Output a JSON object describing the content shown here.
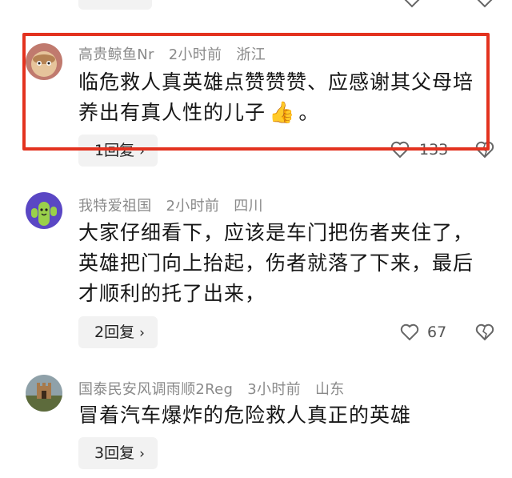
{
  "comments": [
    {
      "user": "高贵鲸鱼Nr",
      "time": "2小时前",
      "location": "浙江",
      "lines": [
        "临危救人真英雄点赞赞赞、应感谢其父母培",
        "养出有真人性的儿子"
      ],
      "emoji": "👍",
      "trailing": "。",
      "reply_label": "1回复",
      "likes": "133",
      "avatar_color": "#b06a5e"
    },
    {
      "user": "我特爱祖国",
      "time": "2小时前",
      "location": "四川",
      "lines": [
        "大家仔细看下，应该是车门把伤者夹住了，",
        "英雄把门向上抬起，伤者就落了下来，最后",
        "才顺利的托了出来，"
      ],
      "reply_label": "2回复",
      "likes": "67",
      "avatar_color": "#5c49c6"
    },
    {
      "user": "国泰民安风调雨顺2Reg",
      "time": "3小时前",
      "location": "山东",
      "lines": [
        "冒着汽车爆炸的危险救人真正的英雄"
      ],
      "reply_label": "3回复",
      "avatar_color": "#6d7d86"
    }
  ],
  "reply_chevron": "›",
  "highlight_color": "#e3321f"
}
